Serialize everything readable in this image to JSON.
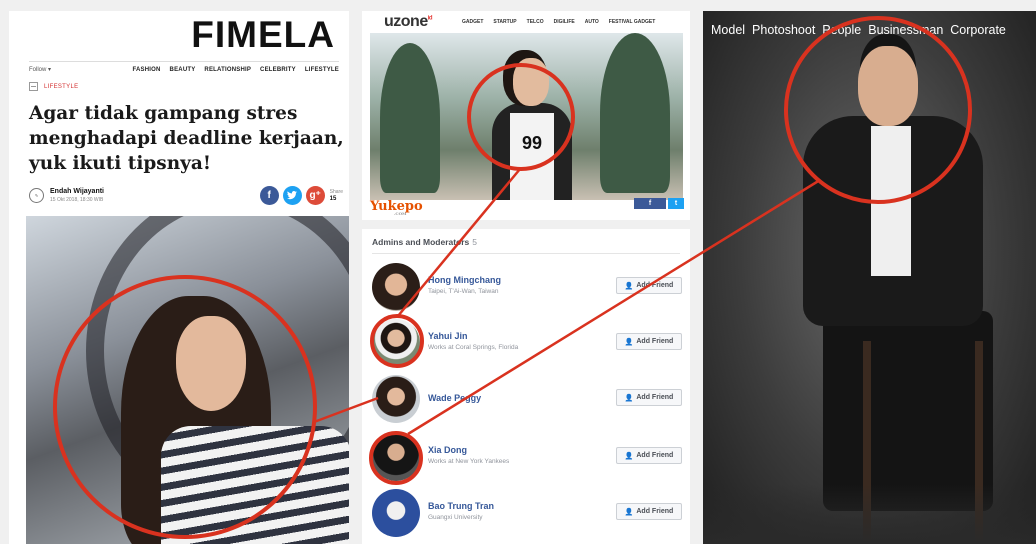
{
  "fimela": {
    "logo": "FIMELA",
    "follow": "Follow ▾",
    "nav": [
      "FASHION",
      "BEAUTY",
      "RELATIONSHIP",
      "CELEBRITY",
      "LIFESTYLE"
    ],
    "category": "LIFESTYLE",
    "headline": "Agar tidak gampang stres menghadapi deadline kerjaan, yuk ikuti tipsnya!",
    "author": "Endah Wijayanti",
    "date": "15 Okt 2018, 18:30 WIB",
    "share_label": "Share",
    "share_count": "15",
    "share_icons": [
      "facebook-icon",
      "twitter-icon",
      "google-plus-icon"
    ]
  },
  "uzone": {
    "logo": "uzone",
    "logo_suffix": "id",
    "nav": [
      "GADGET",
      "STARTUP",
      "TELCO",
      "DIGILIFE",
      "AUTO",
      "FESTIVAL GADGET"
    ],
    "shirt_text": "99",
    "source": "Yukepo",
    "source_suffix": ".COM",
    "share_fb": "f",
    "share_tw": "t"
  },
  "admins": {
    "title": "Admins and Moderators",
    "count": "5",
    "button_label": "Add Friend",
    "members": [
      {
        "name": "Hong Mingchang",
        "sub": "Taipei, T'Ai-Wan, Taiwan"
      },
      {
        "name": "Yahui Jin",
        "sub": "Works at Coral Springs, Florida"
      },
      {
        "name": "Wade Peggy",
        "sub": ""
      },
      {
        "name": "Xia Dong",
        "sub": "Works at New York Yankees"
      },
      {
        "name": "Bao Trung Tran",
        "sub": "Guangxi University"
      }
    ]
  },
  "right_panel": {
    "nav": [
      "Model",
      "Photoshoot",
      "People",
      "Businessman",
      "Corporate"
    ]
  },
  "colors": {
    "highlight_red": "#d9321f",
    "facebook_blue": "#3b5998",
    "link_blue": "#365899"
  }
}
